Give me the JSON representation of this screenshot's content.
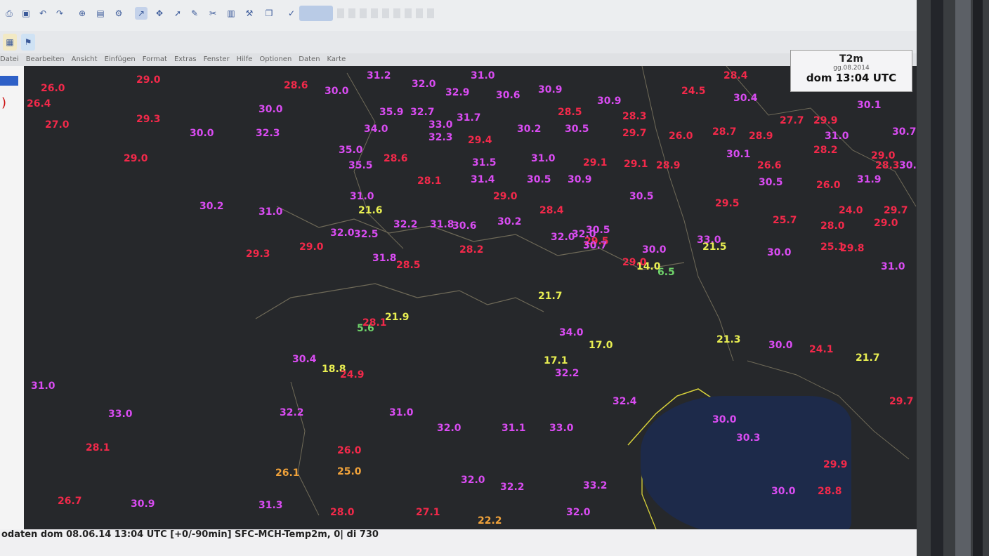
{
  "menu_labels": [
    "Datei",
    "Bearbeiten",
    "Ansicht",
    "Einfügen",
    "Format",
    "Extras",
    "Fenster",
    "Hilfe",
    "Optionen",
    "Daten",
    "Karte"
  ],
  "legend": {
    "title": "T2m",
    "subtitle": "gg.08.2014",
    "time": "dom 13:04 UTC"
  },
  "status_text": "odaten  dom 08.06.14 13:04 UTC [+0/-90min] SFC-MCH-Temp2m, 0| di 730",
  "colors": {
    "red": "#f2294a",
    "magenta": "#d94cf2",
    "yellow": "#e9ef52",
    "green": "#6fd36a",
    "orange": "#f0a23a"
  },
  "stations": [
    {
      "v": "26.0",
      "c": "red"
    },
    {
      "v": "29.0",
      "c": "red"
    },
    {
      "v": "28.6",
      "c": "red"
    },
    {
      "v": "30.0",
      "c": "mag"
    },
    {
      "v": "31.2",
      "c": "mag"
    },
    {
      "v": "32.0",
      "c": "mag"
    },
    {
      "v": "31.0",
      "c": "mag"
    },
    {
      "v": "28.4",
      "c": "red"
    },
    {
      "v": "26.4",
      "c": "red"
    },
    {
      "v": "30.0",
      "c": "mag"
    },
    {
      "v": "32.9",
      "c": "mag"
    },
    {
      "v": "30.6",
      "c": "mag"
    },
    {
      "v": "30.9",
      "c": "mag"
    },
    {
      "v": "30.9",
      "c": "mag"
    },
    {
      "v": "24.5",
      "c": "red"
    },
    {
      "v": "30.4",
      "c": "mag"
    },
    {
      "v": "27.0",
      "c": "red"
    },
    {
      "v": "29.3",
      "c": "red"
    },
    {
      "v": "35.9",
      "c": "mag"
    },
    {
      "v": "32.7",
      "c": "mag"
    },
    {
      "v": "31.7",
      "c": "mag"
    },
    {
      "v": "28.5",
      "c": "red"
    },
    {
      "v": "28.3",
      "c": "red"
    },
    {
      "v": "30.1",
      "c": "mag"
    },
    {
      "v": "30.0",
      "c": "mag"
    },
    {
      "v": "32.3",
      "c": "mag"
    },
    {
      "v": "34.0",
      "c": "mag"
    },
    {
      "v": "33.0",
      "c": "mag"
    },
    {
      "v": "30.2",
      "c": "mag"
    },
    {
      "v": "30.5",
      "c": "mag"
    },
    {
      "v": "29.7",
      "c": "red"
    },
    {
      "v": "27.7",
      "c": "red"
    },
    {
      "v": "29.9",
      "c": "red"
    },
    {
      "v": "30.7",
      "c": "mag"
    },
    {
      "v": "29.0",
      "c": "red"
    },
    {
      "v": "35.0",
      "c": "mag"
    },
    {
      "v": "32.3",
      "c": "mag"
    },
    {
      "v": "29.4",
      "c": "red"
    },
    {
      "v": "28.7",
      "c": "red"
    },
    {
      "v": "26.0",
      "c": "red"
    },
    {
      "v": "28.9",
      "c": "red"
    },
    {
      "v": "31.0",
      "c": "mag"
    },
    {
      "v": "35.5",
      "c": "mag"
    },
    {
      "v": "28.6",
      "c": "red"
    },
    {
      "v": "31.5",
      "c": "mag"
    },
    {
      "v": "31.0",
      "c": "mag"
    },
    {
      "v": "29.1",
      "c": "red"
    },
    {
      "v": "29.1",
      "c": "red"
    },
    {
      "v": "28.9",
      "c": "red"
    },
    {
      "v": "30.1",
      "c": "mag"
    },
    {
      "v": "28.2",
      "c": "red"
    },
    {
      "v": "29.0",
      "c": "red"
    },
    {
      "v": "30.5",
      "c": "mag"
    },
    {
      "v": "28.1",
      "c": "red"
    },
    {
      "v": "31.4",
      "c": "mag"
    },
    {
      "v": "30.5",
      "c": "mag"
    },
    {
      "v": "30.9",
      "c": "mag"
    },
    {
      "v": "26.6",
      "c": "red"
    },
    {
      "v": "28.3",
      "c": "red"
    },
    {
      "v": "30.5",
      "c": "mag"
    },
    {
      "v": "26.0",
      "c": "red"
    },
    {
      "v": "31.9",
      "c": "mag"
    },
    {
      "v": "21.6",
      "c": "yel"
    },
    {
      "v": "31.0",
      "c": "mag"
    },
    {
      "v": "29.0",
      "c": "red"
    },
    {
      "v": "28.4",
      "c": "red"
    },
    {
      "v": "30.5",
      "c": "mag"
    },
    {
      "v": "29.5",
      "c": "red"
    },
    {
      "v": "24.0",
      "c": "red"
    },
    {
      "v": "29.7",
      "c": "red"
    },
    {
      "v": "30.2",
      "c": "mag"
    },
    {
      "v": "31.0",
      "c": "mag"
    },
    {
      "v": "32.0",
      "c": "mag"
    },
    {
      "v": "32.5",
      "c": "mag"
    },
    {
      "v": "32.2",
      "c": "mag"
    },
    {
      "v": "31.8",
      "c": "mag"
    },
    {
      "v": "30.6",
      "c": "mag"
    },
    {
      "v": "30.2",
      "c": "mag"
    },
    {
      "v": "25.7",
      "c": "red"
    },
    {
      "v": "29.0",
      "c": "red"
    },
    {
      "v": "29.0",
      "c": "red"
    },
    {
      "v": "28.2",
      "c": "red"
    },
    {
      "v": "32.0",
      "c": "mag"
    },
    {
      "v": "29.5",
      "c": "red"
    },
    {
      "v": "28.0",
      "c": "red"
    },
    {
      "v": "30.5",
      "c": "mag"
    },
    {
      "v": "32.0",
      "c": "mag"
    },
    {
      "v": "33.0",
      "c": "mag"
    },
    {
      "v": "30.7",
      "c": "mag"
    },
    {
      "v": "30.0",
      "c": "mag"
    },
    {
      "v": "21.5",
      "c": "yel"
    },
    {
      "v": "30.0",
      "c": "mag"
    },
    {
      "v": "25.1",
      "c": "red"
    },
    {
      "v": "29.8",
      "c": "red"
    },
    {
      "v": "14.0",
      "c": "yel"
    },
    {
      "v": "6.5",
      "c": "grn"
    },
    {
      "v": "31.0",
      "c": "mag"
    },
    {
      "v": "29.3",
      "c": "red"
    },
    {
      "v": "31.8",
      "c": "mag"
    },
    {
      "v": "28.5",
      "c": "red"
    },
    {
      "v": "21.7",
      "c": "yel"
    },
    {
      "v": "34.0",
      "c": "mag"
    },
    {
      "v": "17.0",
      "c": "yel"
    },
    {
      "v": "29.0",
      "c": "red"
    },
    {
      "v": "30.4",
      "c": "mag"
    },
    {
      "v": "18.8",
      "c": "yel"
    },
    {
      "v": "24.9",
      "c": "red"
    },
    {
      "v": "21.9",
      "c": "yel"
    },
    {
      "v": "5.6",
      "c": "grn"
    },
    {
      "v": "28.1",
      "c": "red"
    },
    {
      "v": "17.1",
      "c": "yel"
    },
    {
      "v": "32.2",
      "c": "mag"
    },
    {
      "v": "21.3",
      "c": "yel"
    },
    {
      "v": "30.0",
      "c": "mag"
    },
    {
      "v": "24.1",
      "c": "red"
    },
    {
      "v": "21.7",
      "c": "yel"
    },
    {
      "v": "31.0",
      "c": "mag"
    },
    {
      "v": "33.0",
      "c": "mag"
    },
    {
      "v": "32.2",
      "c": "mag"
    },
    {
      "v": "31.0",
      "c": "mag"
    },
    {
      "v": "32.0",
      "c": "mag"
    },
    {
      "v": "31.1",
      "c": "mag"
    },
    {
      "v": "33.0",
      "c": "mag"
    },
    {
      "v": "32.4",
      "c": "mag"
    },
    {
      "v": "30.0",
      "c": "mag"
    },
    {
      "v": "28.1",
      "c": "red"
    },
    {
      "v": "26.0",
      "c": "red"
    },
    {
      "v": "25.0",
      "c": "org"
    },
    {
      "v": "26.1",
      "c": "org"
    },
    {
      "v": "32.0",
      "c": "mag"
    },
    {
      "v": "32.2",
      "c": "mag"
    },
    {
      "v": "33.2",
      "c": "mag"
    },
    {
      "v": "30.3",
      "c": "mag"
    },
    {
      "v": "29.9",
      "c": "red"
    },
    {
      "v": "26.7",
      "c": "red"
    },
    {
      "v": "30.9",
      "c": "mag"
    },
    {
      "v": "31.3",
      "c": "mag"
    },
    {
      "v": "28.0",
      "c": "red"
    },
    {
      "v": "27.1",
      "c": "red"
    },
    {
      "v": "22.2",
      "c": "org"
    },
    {
      "v": "32.0",
      "c": "mag"
    },
    {
      "v": "30.0",
      "c": "mag"
    },
    {
      "v": "28.8",
      "c": "red"
    },
    {
      "v": "29.7",
      "c": "red"
    }
  ]
}
